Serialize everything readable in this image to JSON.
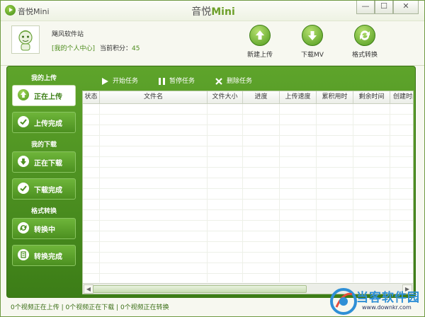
{
  "window": {
    "app_name": "音悦Mini",
    "title_part1": "音悦",
    "title_part2": "Mini",
    "controls": {
      "minimize": "—",
      "maximize": "☐",
      "close": "✕"
    }
  },
  "header": {
    "username": "飓风软件站",
    "my_center": "[我的个人中心]",
    "points_label": "当前积分：",
    "points_value": "45",
    "buttons": [
      {
        "label": "新建上传",
        "icon": "upload-arrow-icon"
      },
      {
        "label": "下载MV",
        "icon": "download-arrow-icon"
      },
      {
        "label": "格式转换",
        "icon": "convert-icon"
      }
    ]
  },
  "sidebar": {
    "sections": [
      {
        "title": "我的上传",
        "items": [
          {
            "label": "正在上传",
            "icon": "upload-arrow-icon",
            "active": true
          },
          {
            "label": "上传完成",
            "icon": "check-icon",
            "active": false
          }
        ]
      },
      {
        "title": "我的下载",
        "items": [
          {
            "label": "正在下载",
            "icon": "download-arrow-icon",
            "active": false
          },
          {
            "label": "下载完成",
            "icon": "check-icon",
            "active": false
          }
        ]
      },
      {
        "title": "格式转换",
        "items": [
          {
            "label": "转换中",
            "icon": "convert-icon",
            "active": false
          },
          {
            "label": "转换完成",
            "icon": "document-icon",
            "active": false
          }
        ]
      }
    ]
  },
  "toolbar": {
    "start": "开始任务",
    "pause": "暂停任务",
    "delete": "删除任务"
  },
  "table": {
    "columns": [
      "状态",
      "文件名",
      "文件大小",
      "进度",
      "上传速度",
      "累积用时",
      "剩余时间",
      "创建时间"
    ]
  },
  "statusbar": {
    "text": "0个视频正在上传 | 0个视频正在下载 | 0个视频正在转换"
  },
  "watermark": {
    "text": "当客软件园",
    "url": "www.downkr.com"
  },
  "colors": {
    "accent_green": "#4c9020",
    "title_green": "#6d9f29"
  }
}
